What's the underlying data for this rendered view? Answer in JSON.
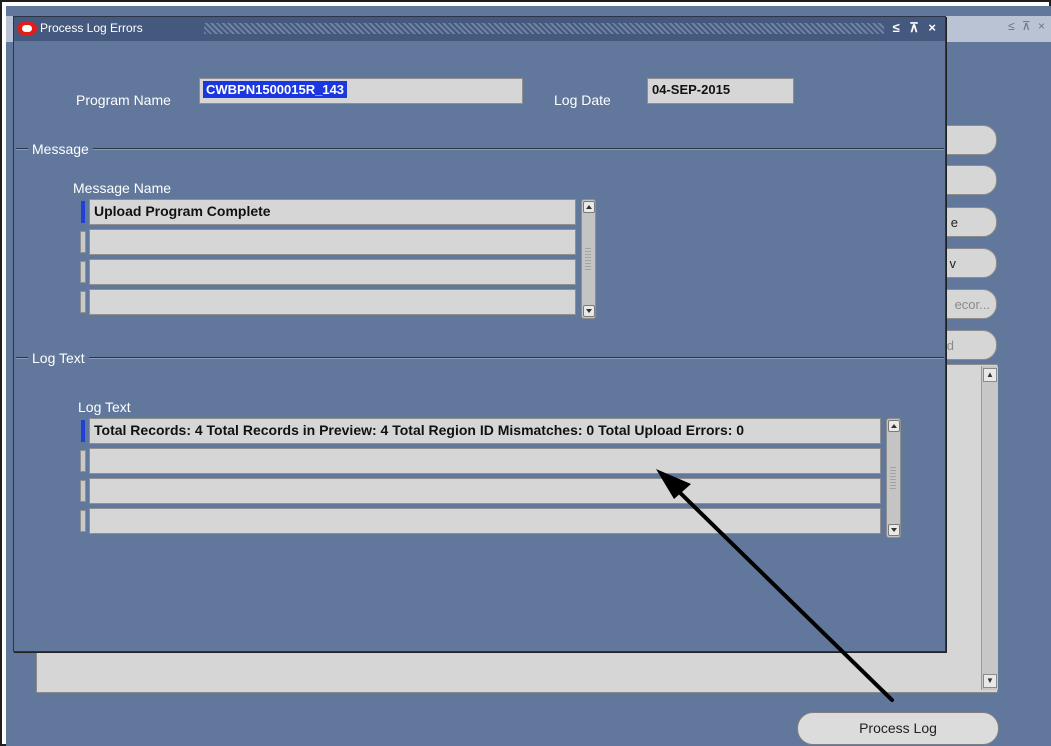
{
  "background": {
    "buttons": [
      {
        "label": ""
      },
      {
        "label": ""
      },
      {
        "label": "e"
      },
      {
        "label": "v"
      },
      {
        "label": "ecor..."
      },
      {
        "label": "d"
      }
    ],
    "process_log_label": "Process Log",
    "window_controls": "≤ ⊼ ×"
  },
  "dialog": {
    "title": "Process Log Errors",
    "controls": "≤ ⊼ ×",
    "program_name_label": "Program Name",
    "program_name_value": "CWBPN1500015R_143",
    "log_date_label": "Log Date",
    "log_date_value": "04-SEP-2015",
    "message_section": {
      "title": "Message",
      "column_label": "Message Name",
      "rows": [
        "Upload Program Complete",
        "",
        "",
        ""
      ]
    },
    "log_section": {
      "title": "Log Text",
      "column_label": "Log Text",
      "rows": [
        "Total Records: 4 Total Records in Preview: 4 Total Region ID Mismatches: 0 Total Upload Errors: 0",
        "",
        "",
        ""
      ]
    }
  },
  "colors": {
    "window_bg": "#61779b",
    "field_bg": "#d6d6d6",
    "selection": "#1a37e0",
    "title_bar": "#45597e"
  }
}
